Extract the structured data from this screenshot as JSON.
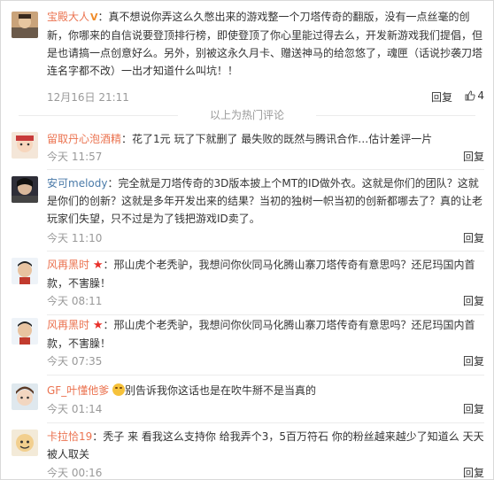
{
  "comments_top": [
    {
      "user": "宝殿大人",
      "verified": "V",
      "text": "：真不想说你弄这么久憋出来的游戏整一个刀塔传奇的翻版，没有一点丝毫的创新，你哪来的自信说要登顶排行榜，即使登顶了你心里能过得去么，开发新游戏我们提倡，但是也请搞一点创意好么。另外，别被这永久月卡、赠送神马的给忽悠了，魂匣（话说抄袭刀塔连名字都不改）一出才知道什么叫坑！！",
      "time": "12月16日 21:11",
      "reply": "回复",
      "likes": "4"
    }
  ],
  "divider_text": "以上为热门评论",
  "comments": [
    {
      "user": "留取丹心泡酒精",
      "text": "：花了1元 玩了下就删了 最失败的既然与腾讯合作…估计差评一片",
      "time": "今天 11:57",
      "reply": "回复"
    },
    {
      "user": "安可melody",
      "text": "：完全就是刀塔传奇的3D版本披上个MT的ID做外衣。这就是你们的团队？这就是你们的创新？这就是多年开发出来的结果？当初的独树一帜当初的创新都哪去了？真的让老玩家们失望，只不过是为了钱把游戏ID卖了。",
      "time": "今天 11:10",
      "reply": "回复"
    },
    {
      "user": "风再黑时",
      "text": "：邢山虎个老秃驴，我想问你伙同马化腾山寨刀塔传奇有意思吗？还尼玛国内首款，不害臊！",
      "time": "今天 08:11",
      "reply": "回复"
    },
    {
      "user": "风再黑时",
      "text": "：邢山虎个老秃驴，我想问你伙同马化腾山寨刀塔传奇有意思吗？还尼玛国内首款，不害臊！",
      "time": "今天 07:35",
      "reply": "回复"
    },
    {
      "user": "GF_叶懂他爹",
      "text": "别告诉我你这话也是在吹牛掰不是当真的",
      "time": "今天 01:14",
      "reply": "回复"
    },
    {
      "user": "卡拉恰19",
      "text": "：秃子 来 看我这么支持你 给我弄个3，5百万符石 你的粉丝越来越少了知道么 天天被人取关",
      "time": "今天 00:16",
      "reply": "回复"
    }
  ],
  "icons": {
    "thumb": "thumbs-up-icon",
    "star": "star-icon",
    "emoji": "laughing-emoji-icon"
  },
  "colors": {
    "username": "#eb7350",
    "username_alt": "#4a7aa8",
    "meta": "#999999",
    "text": "#333333",
    "star": "#e8302a"
  }
}
